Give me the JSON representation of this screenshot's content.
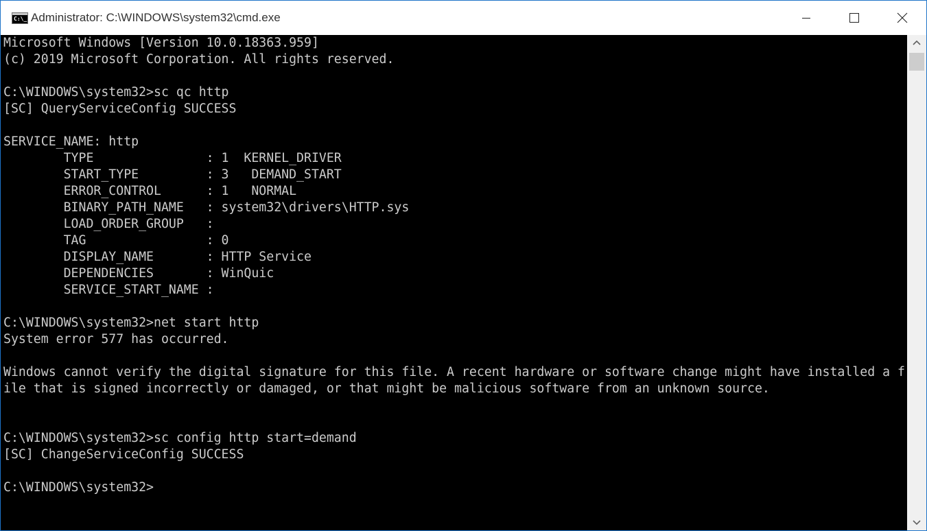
{
  "window": {
    "title": "Administrator: C:\\WINDOWS\\system32\\cmd.exe",
    "minimize_label": "Minimize",
    "maximize_label": "Maximize",
    "close_label": "Close"
  },
  "console": {
    "lines": [
      "Microsoft Windows [Version 10.0.18363.959]",
      "(c) 2019 Microsoft Corporation. All rights reserved.",
      "",
      "C:\\WINDOWS\\system32>sc qc http",
      "[SC] QueryServiceConfig SUCCESS",
      "",
      "SERVICE_NAME: http",
      "        TYPE               : 1  KERNEL_DRIVER",
      "        START_TYPE         : 3   DEMAND_START",
      "        ERROR_CONTROL      : 1   NORMAL",
      "        BINARY_PATH_NAME   : system32\\drivers\\HTTP.sys",
      "        LOAD_ORDER_GROUP   :",
      "        TAG                : 0",
      "        DISPLAY_NAME       : HTTP Service",
      "        DEPENDENCIES       : WinQuic",
      "        SERVICE_START_NAME :",
      "",
      "C:\\WINDOWS\\system32>net start http",
      "System error 577 has occurred.",
      "",
      "Windows cannot verify the digital signature for this file. A recent hardware or software change might have installed a f",
      "ile that is signed incorrectly or damaged, or that might be malicious software from an unknown source.",
      "",
      "",
      "C:\\WINDOWS\\system32>sc config http start=demand",
      "[SC] ChangeServiceConfig SUCCESS",
      "",
      "C:\\WINDOWS\\system32>"
    ]
  },
  "icons": {
    "app": "cmd-icon",
    "minimize": "minimize-icon",
    "maximize": "maximize-icon",
    "close": "close-icon",
    "scroll_up": "chevron-up-icon",
    "scroll_down": "chevron-down-icon"
  },
  "colors": {
    "console_background": "#000000",
    "console_text": "#cccccc",
    "titlebar_background": "#ffffff",
    "window_border": "#1e74c9"
  }
}
